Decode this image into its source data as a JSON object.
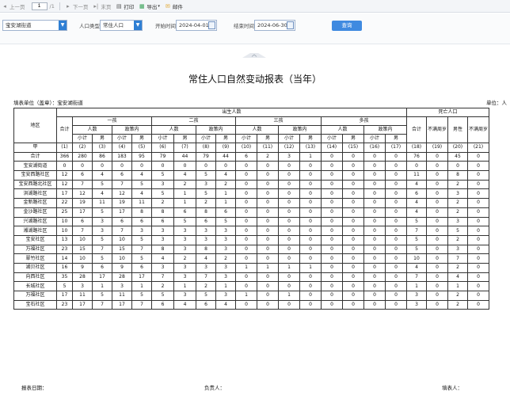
{
  "toolbar": {
    "prev_label": "上一页",
    "page_value": "1",
    "page_total": "/1",
    "next_label": "下一页",
    "last_label": "末页",
    "print_label": "打印",
    "export_label": "导出",
    "email_label": "邮件"
  },
  "filters": {
    "region_value": "宝安湖街道",
    "population_label": "人口类型",
    "population_value": "常住人口",
    "start_label": "开始时间",
    "start_value": "2024-04-01",
    "end_label": "结束时间",
    "end_value": "2024-06-30",
    "query_label": "查询"
  },
  "report": {
    "title": "常住人口自然变动报表（当年）",
    "unit_label": "填表单位（盖章）：宝安湖街道",
    "unit_right": "单位：人",
    "headers": {
      "region": "地区",
      "births": "出生人数",
      "deaths": "死亡人口",
      "total": "合计",
      "first": "一孩",
      "second": "二孩",
      "third": "三孩",
      "multi": "多孩",
      "persons": "人数",
      "policy": "政策内",
      "subtotal": "小计",
      "male": "男",
      "unclear": "不满周岁",
      "male_d": "男性",
      "unclear2": "不满周岁",
      "jia": "甲"
    },
    "col_codes": [
      "(1)",
      "(2)",
      "(3)",
      "(4)",
      "(5)",
      "(6)",
      "(7)",
      "(8)",
      "(9)",
      "(10)",
      "(11)",
      "(12)",
      "(13)",
      "(14)",
      "(15)",
      "(16)",
      "(17)",
      "(18)",
      "(19)",
      "(20)",
      "(21)"
    ],
    "rows": [
      {
        "name": "合计",
        "v": [
          "366",
          "280",
          "86",
          "183",
          "95",
          "79",
          "44",
          "79",
          "44",
          "6",
          "2",
          "3",
          "1",
          "0",
          "0",
          "0",
          "0",
          "76",
          "0",
          "45",
          "0"
        ]
      },
      {
        "name": "宝安湖街道",
        "v": [
          "0",
          "0",
          "0",
          "0",
          "0",
          "0",
          "0",
          "0",
          "0",
          "0",
          "0",
          "0",
          "0",
          "0",
          "0",
          "0",
          "0",
          "0",
          "0",
          "0",
          "0"
        ]
      },
      {
        "name": "宝安西路社区",
        "v": [
          "12",
          "6",
          "4",
          "6",
          "4",
          "5",
          "4",
          "5",
          "4",
          "0",
          "0",
          "0",
          "0",
          "0",
          "0",
          "0",
          "0",
          "11",
          "0",
          "8",
          "0"
        ]
      },
      {
        "name": "宝安西路北社区",
        "v": [
          "12",
          "7",
          "5",
          "7",
          "5",
          "3",
          "2",
          "3",
          "2",
          "0",
          "0",
          "0",
          "0",
          "0",
          "0",
          "0",
          "0",
          "4",
          "0",
          "2",
          "0"
        ]
      },
      {
        "name": "洪湖路社区",
        "v": [
          "17",
          "12",
          "4",
          "12",
          "4",
          "5",
          "1",
          "5",
          "1",
          "0",
          "0",
          "0",
          "0",
          "0",
          "0",
          "0",
          "0",
          "6",
          "0",
          "3",
          "0"
        ]
      },
      {
        "name": "金新路社区",
        "v": [
          "22",
          "19",
          "11",
          "19",
          "11",
          "2",
          "1",
          "2",
          "1",
          "0",
          "0",
          "0",
          "0",
          "0",
          "0",
          "0",
          "0",
          "4",
          "0",
          "2",
          "0"
        ]
      },
      {
        "name": "金沙路社区",
        "v": [
          "25",
          "17",
          "5",
          "17",
          "8",
          "8",
          "6",
          "8",
          "6",
          "0",
          "0",
          "0",
          "0",
          "0",
          "0",
          "0",
          "0",
          "4",
          "0",
          "2",
          "0"
        ]
      },
      {
        "name": "兴湖路社区",
        "v": [
          "10",
          "6",
          "3",
          "6",
          "6",
          "6",
          "5",
          "6",
          "5",
          "0",
          "0",
          "0",
          "0",
          "0",
          "0",
          "0",
          "0",
          "5",
          "0",
          "3",
          "0"
        ]
      },
      {
        "name": "湘湖路社区",
        "v": [
          "10",
          "7",
          "3",
          "7",
          "3",
          "3",
          "3",
          "3",
          "3",
          "0",
          "0",
          "0",
          "0",
          "0",
          "0",
          "0",
          "0",
          "7",
          "0",
          "5",
          "0"
        ]
      },
      {
        "name": "宝安社区",
        "v": [
          "13",
          "10",
          "5",
          "10",
          "5",
          "3",
          "3",
          "3",
          "3",
          "0",
          "0",
          "0",
          "0",
          "0",
          "0",
          "0",
          "0",
          "5",
          "0",
          "2",
          "0"
        ]
      },
      {
        "name": "万福社区",
        "v": [
          "23",
          "15",
          "7",
          "15",
          "7",
          "8",
          "3",
          "8",
          "3",
          "0",
          "0",
          "0",
          "0",
          "0",
          "0",
          "0",
          "0",
          "5",
          "0",
          "3",
          "0"
        ]
      },
      {
        "name": "翠竹社区",
        "v": [
          "14",
          "10",
          "5",
          "10",
          "5",
          "4",
          "2",
          "4",
          "2",
          "0",
          "0",
          "0",
          "0",
          "0",
          "0",
          "0",
          "0",
          "10",
          "0",
          "7",
          "0"
        ]
      },
      {
        "name": "湖贝社区",
        "v": [
          "16",
          "9",
          "6",
          "9",
          "6",
          "3",
          "3",
          "3",
          "3",
          "1",
          "1",
          "1",
          "1",
          "0",
          "0",
          "0",
          "0",
          "4",
          "0",
          "2",
          "0"
        ]
      },
      {
        "name": "向西社区",
        "v": [
          "35",
          "28",
          "17",
          "28",
          "17",
          "7",
          "3",
          "7",
          "3",
          "0",
          "0",
          "0",
          "0",
          "0",
          "0",
          "0",
          "0",
          "7",
          "0",
          "4",
          "0"
        ]
      },
      {
        "name": "长城社区",
        "v": [
          "5",
          "3",
          "1",
          "3",
          "1",
          "2",
          "1",
          "2",
          "1",
          "0",
          "0",
          "0",
          "0",
          "0",
          "0",
          "0",
          "0",
          "1",
          "0",
          "1",
          "0"
        ]
      },
      {
        "name": "万福社区",
        "v": [
          "17",
          "11",
          "5",
          "11",
          "5",
          "5",
          "3",
          "5",
          "3",
          "1",
          "0",
          "1",
          "0",
          "0",
          "0",
          "0",
          "0",
          "3",
          "0",
          "2",
          "0"
        ]
      },
      {
        "name": "宝石社区",
        "v": [
          "23",
          "17",
          "7",
          "17",
          "7",
          "6",
          "4",
          "6",
          "4",
          "0",
          "0",
          "0",
          "0",
          "0",
          "0",
          "0",
          "0",
          "3",
          "0",
          "2",
          "0"
        ]
      }
    ],
    "footer": {
      "date_label": "报表日期：",
      "manager_label": "负责人：",
      "filler_label": "填表人："
    }
  }
}
